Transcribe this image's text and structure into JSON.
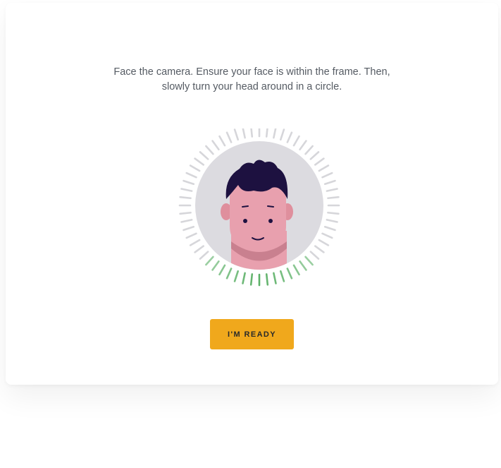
{
  "instructions": {
    "line1": "Face the camera. Ensure your face is within the frame. Then,",
    "line2": "slowly turn your head around in a circle."
  },
  "scan_ring": {
    "progress": 0.23,
    "active_color": "#5db168",
    "inactive_color": "#d6d6da"
  },
  "avatar": {
    "background_color": "#dcdbe0",
    "skin_color": "#e8a0ae",
    "hair_color": "#1d1140"
  },
  "ready_button": {
    "label": "I'M READY",
    "color": "#f0a81c"
  }
}
